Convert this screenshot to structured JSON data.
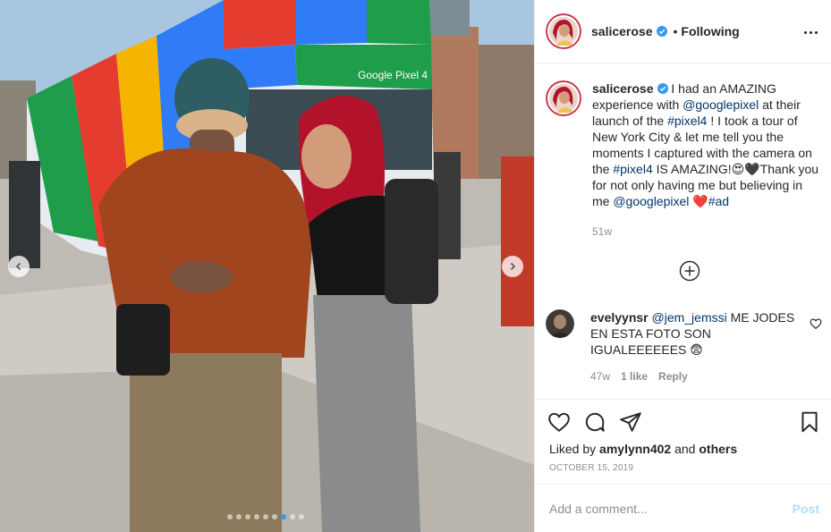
{
  "header": {
    "username": "salicerose",
    "separator": "•",
    "follow_status": "Following"
  },
  "caption": {
    "username": "salicerose",
    "seg1": " I had an AMAZING experience with ",
    "mention1": "@googlepixel",
    "seg2": " at their launch of the ",
    "hashtag1": "#pixel4",
    "seg3": " ! I took a tour of New York City & let me tell you the moments I captured with the camera on the ",
    "hashtag2": "#pixel4",
    "seg4": " IS AMAZING!😍🖤Thank you for not only having me but believing in me ",
    "mention2": "@googlepixel",
    "seg5": " ❤️",
    "hashtag3": "#ad",
    "time": "51w"
  },
  "comment": {
    "username": "evelyynsr",
    "mention": "@jem_jemssi",
    "text": " ME JODES EN ESTA FOTO SON IGUALEEEEEES 😨",
    "time": "47w",
    "likes": "1 like",
    "reply_label": "Reply"
  },
  "likes": {
    "prefix": "Liked by ",
    "user": "amylynn402",
    "middle": " and ",
    "others": "others"
  },
  "date": "OCTOBER 15, 2019",
  "composer": {
    "placeholder": "Add a comment...",
    "post_label": "Post"
  },
  "photo": {
    "bus_brand": "Google Pixel 4",
    "carousel_count": 9,
    "carousel_active": 7
  },
  "colors": {
    "link": "#00376b",
    "verified": "#3897f0",
    "meta": "#8e8e8e",
    "post_button": "#b3dbff"
  }
}
